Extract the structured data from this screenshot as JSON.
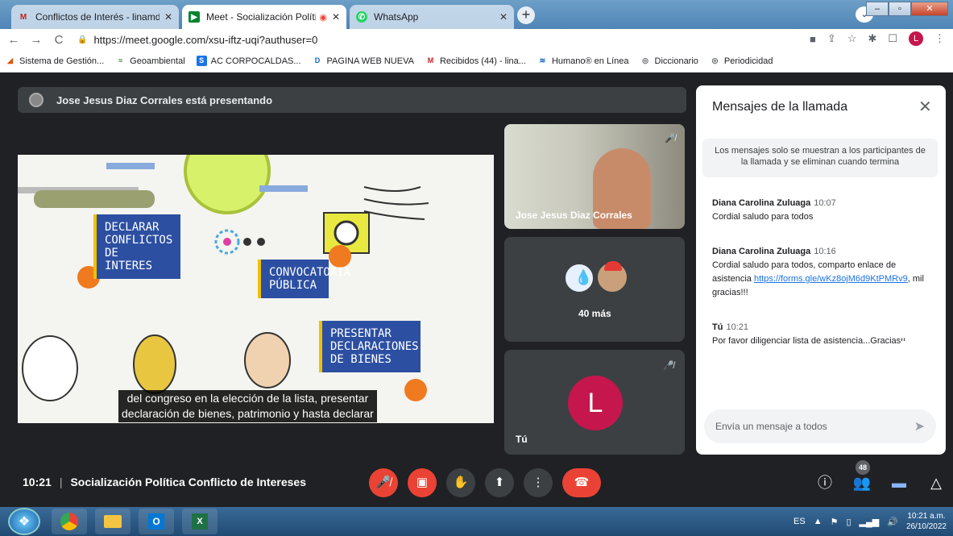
{
  "browser": {
    "tabs": [
      {
        "favicon": "gmail-icon",
        "title": "Conflictos de Interés - linamdaza",
        "active": false
      },
      {
        "favicon": "meet-icon",
        "title": "Meet - Socialización Política",
        "active": true
      },
      {
        "favicon": "whatsapp-icon",
        "title": "WhatsApp",
        "active": false
      }
    ],
    "url": "https://meet.google.com/xsu-iftz-uqi?authuser=0",
    "profile_initial": "L",
    "bookmarks": [
      "Sistema de Gestión...",
      "Geoambiental",
      "AC CORPOCALDAS...",
      "PAGINA WEB NUEVA",
      "Recibidos (44) - lina...",
      "Humano® en Línea",
      "Diccionario",
      "Periodicidad"
    ]
  },
  "meeting": {
    "presenter_banner": "Jose Jesus Diaz Corrales está presentando",
    "slide": {
      "box1": "DECLARAR CONFLICTOS DE INTERES",
      "box2": "CONVOCATORIA PÚBLICA",
      "box3": "PRESENTAR DECLARACIONES DE BIENES",
      "caption_line1": "del congreso en la elección de la lista, presentar",
      "caption_line2": "declaración de bienes, patrimonio y hasta declarar"
    },
    "participants": {
      "presenter_name": "Jose Jesus Diaz Corrales",
      "more_label": "40 más",
      "self_label": "Tú",
      "self_initial": "L"
    },
    "time": "10:21",
    "title": "Socialización Política Conflicto de Intereses",
    "people_count": "48"
  },
  "chat": {
    "title": "Mensajes de la llamada",
    "notice": "Los mensajes solo se muestran a los participantes de la llamada y se eliminan cuando termina",
    "messages": [
      {
        "sender": "Diana Carolina Zuluaga",
        "time": "10:07",
        "text": "Cordial saludo para todos"
      },
      {
        "sender": "Diana Carolina Zuluaga",
        "time": "10:16",
        "text_before": "Cordial saludo para todos, comparto enlace de asistencia ",
        "link": "https://forms.gle/wKz8ojM6d9KtPMRv9",
        "text_after": ", mil gracias!!!"
      },
      {
        "sender": "Tú",
        "time": "10:21",
        "text": "Por favor diligenciar lista de asistencia...Graciasיי"
      }
    ],
    "input_placeholder": "Envía un mensaje a todos"
  },
  "taskbar": {
    "language": "ES",
    "time": "10:21 a.m.",
    "date": "26/10/2022"
  }
}
